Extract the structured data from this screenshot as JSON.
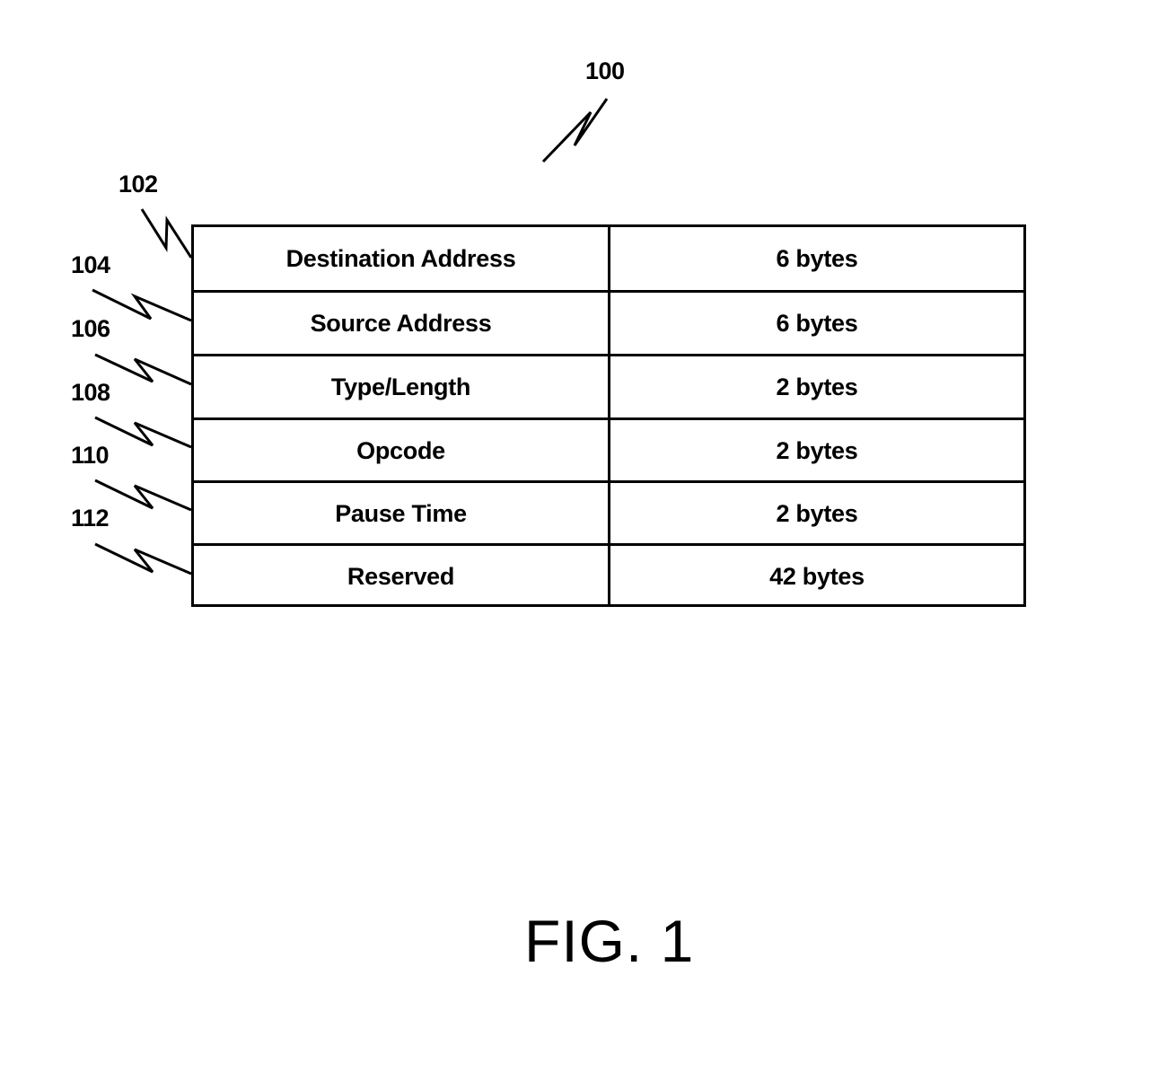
{
  "figure": {
    "reference": "100",
    "caption": "FIG. 1"
  },
  "table": {
    "reference": "102",
    "rows": [
      {
        "ref": "102",
        "field": "Destination Address",
        "size": "6 bytes"
      },
      {
        "ref": "104",
        "field": "Source Address",
        "size": "6 bytes"
      },
      {
        "ref": "106",
        "field": "Type/Length",
        "size": "2 bytes"
      },
      {
        "ref": "108",
        "field": "Opcode",
        "size": "2 bytes"
      },
      {
        "ref": "110",
        "field": "Pause Time",
        "size": "2 bytes"
      },
      {
        "ref": "112",
        "field": "Reserved",
        "size": "42 bytes"
      }
    ]
  }
}
